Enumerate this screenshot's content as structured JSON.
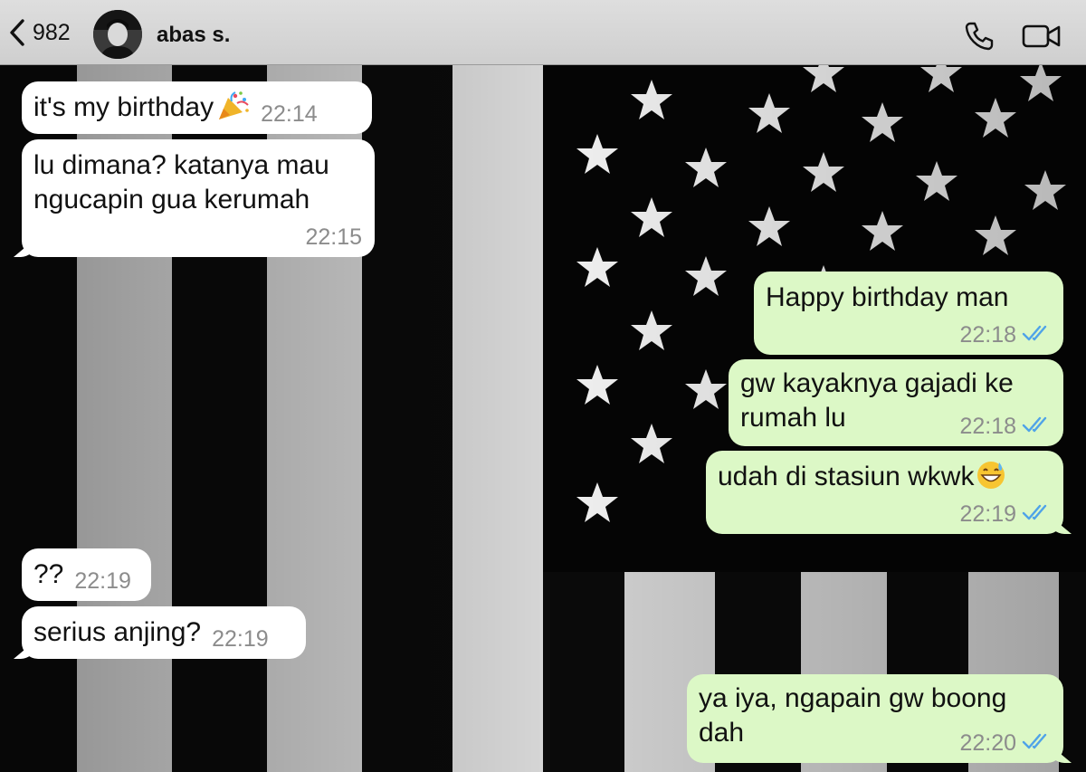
{
  "header": {
    "back_count": "982",
    "contact_name": "abas s."
  },
  "messages": [
    {
      "id": "m1",
      "direction": "in",
      "text": "it's my birthday",
      "emoji": "party-popper",
      "time": "22:14"
    },
    {
      "id": "m2",
      "direction": "in",
      "text": "lu dimana? katanya mau\nngucapin gua kerumah",
      "time": "22:15"
    },
    {
      "id": "m3",
      "direction": "out",
      "text": "Happy birthday man",
      "time": "22:18",
      "status": "read"
    },
    {
      "id": "m4",
      "direction": "out",
      "text": "gw kayaknya gajadi ke\nrumah lu",
      "time": "22:18",
      "status": "read"
    },
    {
      "id": "m5",
      "direction": "out",
      "text": "udah di stasiun wkwk",
      "emoji": "grinning-face-with-sweat",
      "time": "22:19",
      "status": "read"
    },
    {
      "id": "m6",
      "direction": "in",
      "text": "??",
      "time": "22:19"
    },
    {
      "id": "m7",
      "direction": "in",
      "text": "serius anjing?",
      "time": "22:19"
    },
    {
      "id": "m8",
      "direction": "out",
      "text": "ya iya, ngapain gw boong\ndah",
      "time": "22:20",
      "status": "read"
    }
  ],
  "colors": {
    "incoming_bubble": "#ffffff",
    "outgoing_bubble": "#dcf8c6",
    "timestamp": "#8c8c8c",
    "read_ticks": "#4fa3e8",
    "header_bg": "#d6d6d6"
  },
  "icons": {
    "back": "chevron-left-icon",
    "call": "phone-icon",
    "video": "video-camera-icon",
    "read_status": "double-check-icon"
  }
}
